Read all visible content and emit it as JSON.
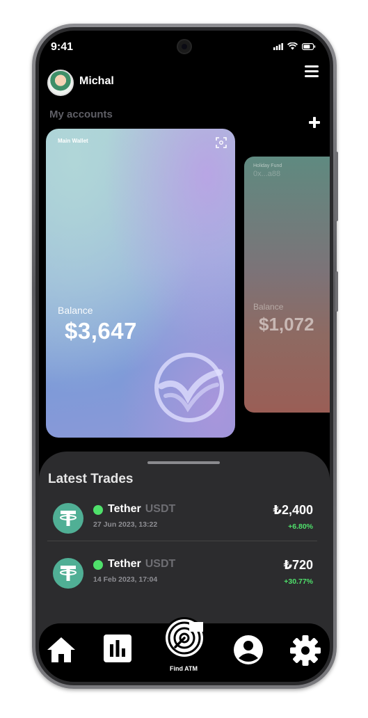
{
  "status_bar": {
    "time": "9:41"
  },
  "header": {
    "username": "Michal"
  },
  "accounts": {
    "section_label": "My accounts",
    "cards": [
      {
        "name": "Main Wallet",
        "balance_label": "Balance",
        "balance": "$3,647"
      },
      {
        "name": "Holiday Fund",
        "address": "0x...a88",
        "balance_label": "Balance",
        "balance": "$1,072"
      }
    ]
  },
  "trades": {
    "title": "Latest Trades",
    "items": [
      {
        "name": "Tether",
        "symbol": "USDT",
        "date": "27 Jun 2023, 13:22",
        "amount": "₺2,400",
        "change": "+6.80%"
      },
      {
        "name": "Tether",
        "symbol": "USDT",
        "date": "14 Feb 2023, 17:04",
        "amount": "₺720",
        "change": "+30.77%"
      }
    ]
  },
  "nav": {
    "find_atm_label": "Find ATM"
  },
  "colors": {
    "accent_green": "#4fe06b",
    "tether_green": "#50af95",
    "sheet_bg": "#2c2c2e"
  }
}
